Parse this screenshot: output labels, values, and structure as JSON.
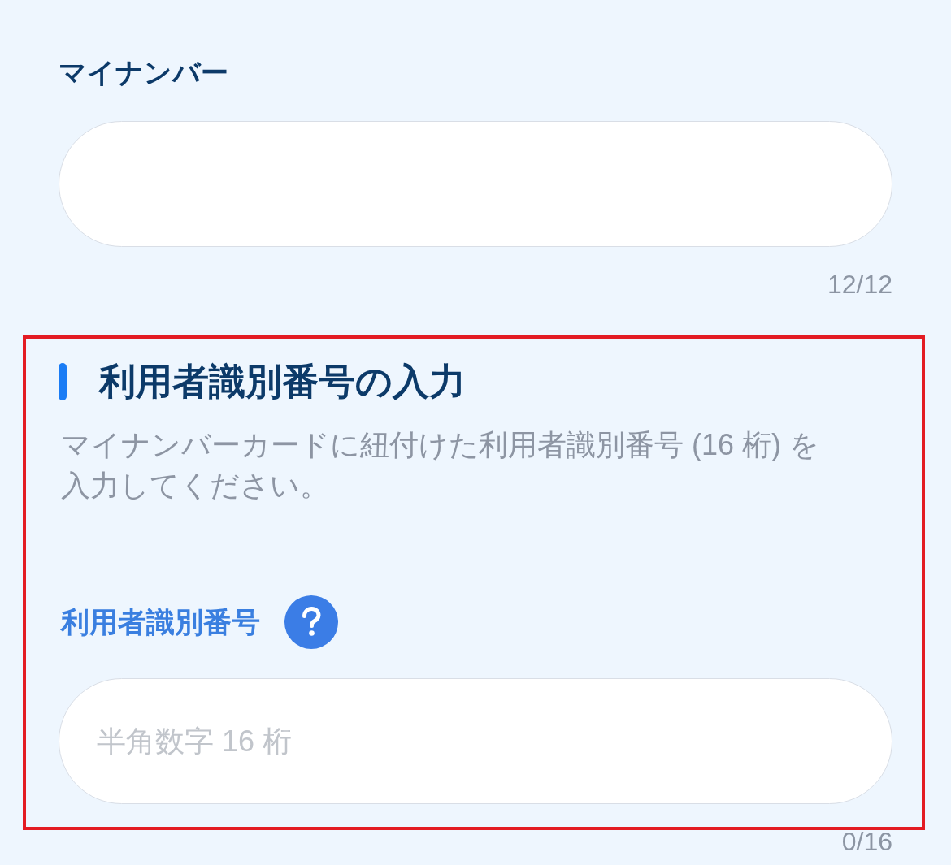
{
  "my_number": {
    "label": "マイナンバー",
    "counter": "12/12"
  },
  "user_id_section": {
    "highlighted": true,
    "title": "利用者識別番号の入力",
    "description": "マイナンバーカードに紐付けた利用者識別番号 (16 桁) を入力してください。",
    "field": {
      "label": "利用者識別番号",
      "has_help": true,
      "placeholder": "半角数字 16 桁",
      "counter": "0/16"
    }
  }
}
